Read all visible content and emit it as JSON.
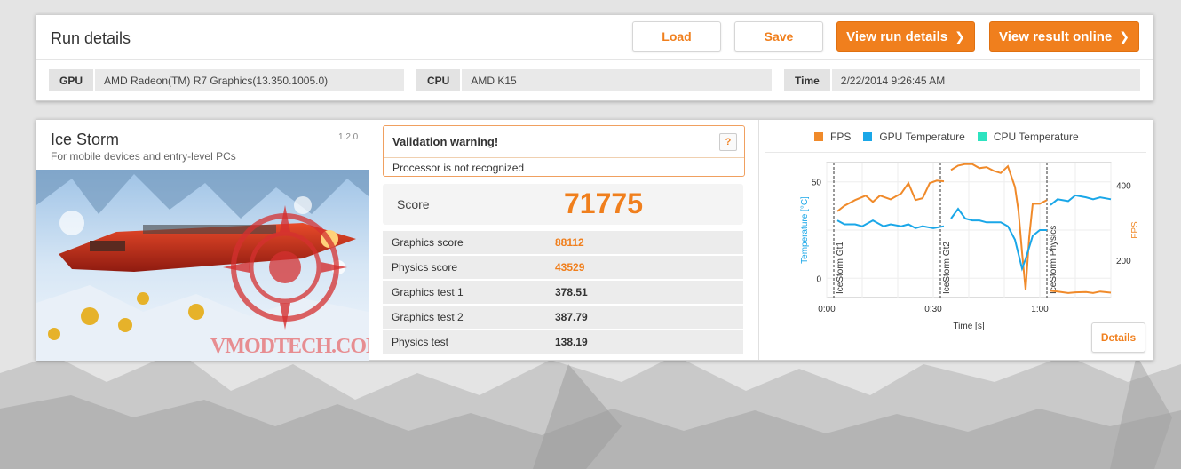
{
  "run": {
    "title": "Run details",
    "load_label": "Load",
    "save_label": "Save",
    "view_details_label": "View run details",
    "view_online_label": "View result online",
    "gpu_label": "GPU",
    "gpu_value": "AMD Radeon(TM) R7 Graphics(13.350.1005.0)",
    "cpu_label": "CPU",
    "cpu_value": "AMD K15",
    "time_label": "Time",
    "time_value": "2/22/2014 9:26:45 AM"
  },
  "test": {
    "name": "Ice Storm",
    "subtitle": "For mobile devices and entry-level PCs",
    "version": "1.2.0",
    "watermark": "VMODTECH.COM"
  },
  "warning": {
    "title": "Validation warning!",
    "help": "?",
    "text": "Processor is not recognized"
  },
  "score": {
    "label": "Score",
    "value": "71775"
  },
  "results": [
    {
      "label": "Graphics score",
      "value": "88112",
      "highlight": true
    },
    {
      "label": "Physics score",
      "value": "43529",
      "highlight": true
    },
    {
      "label": "Graphics test 1",
      "value": "378.51",
      "highlight": false
    },
    {
      "label": "Graphics test 2",
      "value": "387.79",
      "highlight": false
    },
    {
      "label": "Physics test",
      "value": "138.19",
      "highlight": false
    }
  ],
  "colors": {
    "accent": "#f07f1d",
    "fps": "#f08a2a",
    "gpu_temp": "#1aa7e8",
    "cpu_temp": "#2de3c0"
  },
  "details_label": "Details",
  "chart_data": {
    "type": "line",
    "legend": [
      "FPS",
      "GPU Temperature",
      "CPU Temperature"
    ],
    "legend_placement": "top",
    "xlabel": "Time [s]",
    "ylabel_left": "Temperature [°C]",
    "ylabel_right": "FPS",
    "x_ticks": [
      "0:00",
      "0:30",
      "1:00"
    ],
    "y_left_ticks": [
      "0",
      "50"
    ],
    "y_right_ticks": [
      "200",
      "400"
    ],
    "xlim": [
      0,
      80
    ],
    "ylim_left": [
      -10,
      60
    ],
    "ylim_right": [
      100,
      460
    ],
    "segments": [
      {
        "label": "IceStorm Gt1",
        "start": 2
      },
      {
        "label": "IceStorm Gt2",
        "start": 32
      },
      {
        "label": "IceStorm Physics",
        "start": 62
      }
    ],
    "series": [
      {
        "name": "FPS",
        "axis": "right",
        "segments": [
          [
            [
              3,
              330
            ],
            [
              5,
              345
            ],
            [
              8,
              360
            ],
            [
              11,
              372
            ],
            [
              13,
              355
            ],
            [
              15,
              372
            ],
            [
              18,
              362
            ],
            [
              21,
              378
            ],
            [
              23,
              405
            ],
            [
              25,
              360
            ],
            [
              27,
              365
            ],
            [
              29,
              405
            ],
            [
              31,
              412
            ],
            [
              33,
              410
            ]
          ],
          [
            [
              35,
              440
            ],
            [
              37,
              452
            ],
            [
              39,
              456
            ],
            [
              41,
              456
            ],
            [
              43,
              445
            ],
            [
              45,
              448
            ],
            [
              47,
              438
            ],
            [
              49,
              432
            ],
            [
              51,
              450
            ],
            [
              53,
              395
            ],
            [
              54,
              330
            ],
            [
              55,
              220
            ],
            [
              56,
              120
            ],
            [
              57,
              260
            ],
            [
              58,
              350
            ],
            [
              60,
              350
            ],
            [
              62,
              360
            ]
          ],
          [
            [
              63,
              118
            ],
            [
              65,
              116
            ],
            [
              68,
              112
            ],
            [
              70,
              114
            ],
            [
              73,
              115
            ],
            [
              75,
              112
            ],
            [
              77,
              116
            ],
            [
              80,
              113
            ]
          ]
        ]
      },
      {
        "name": "GPU Temperature",
        "axis": "left",
        "segments": [
          [
            [
              3,
              30
            ],
            [
              5,
              28
            ],
            [
              8,
              28
            ],
            [
              10,
              27
            ],
            [
              13,
              30
            ],
            [
              16,
              27
            ],
            [
              18,
              28
            ],
            [
              21,
              27
            ],
            [
              23,
              28
            ],
            [
              25,
              26
            ],
            [
              27,
              27
            ],
            [
              30,
              26
            ],
            [
              33,
              27
            ]
          ],
          [
            [
              35,
              31
            ],
            [
              37,
              36
            ],
            [
              39,
              31
            ],
            [
              41,
              30
            ],
            [
              43,
              30
            ],
            [
              45,
              29
            ],
            [
              47,
              29
            ],
            [
              49,
              29
            ],
            [
              51,
              27
            ],
            [
              53,
              20
            ],
            [
              55,
              5
            ],
            [
              56,
              10
            ],
            [
              58,
              22
            ],
            [
              60,
              25
            ],
            [
              62,
              25
            ]
          ],
          [
            [
              63,
              38
            ],
            [
              65,
              41
            ],
            [
              68,
              40
            ],
            [
              70,
              43
            ],
            [
              73,
              42
            ],
            [
              75,
              41
            ],
            [
              77,
              42
            ],
            [
              80,
              41
            ]
          ]
        ]
      }
    ]
  }
}
